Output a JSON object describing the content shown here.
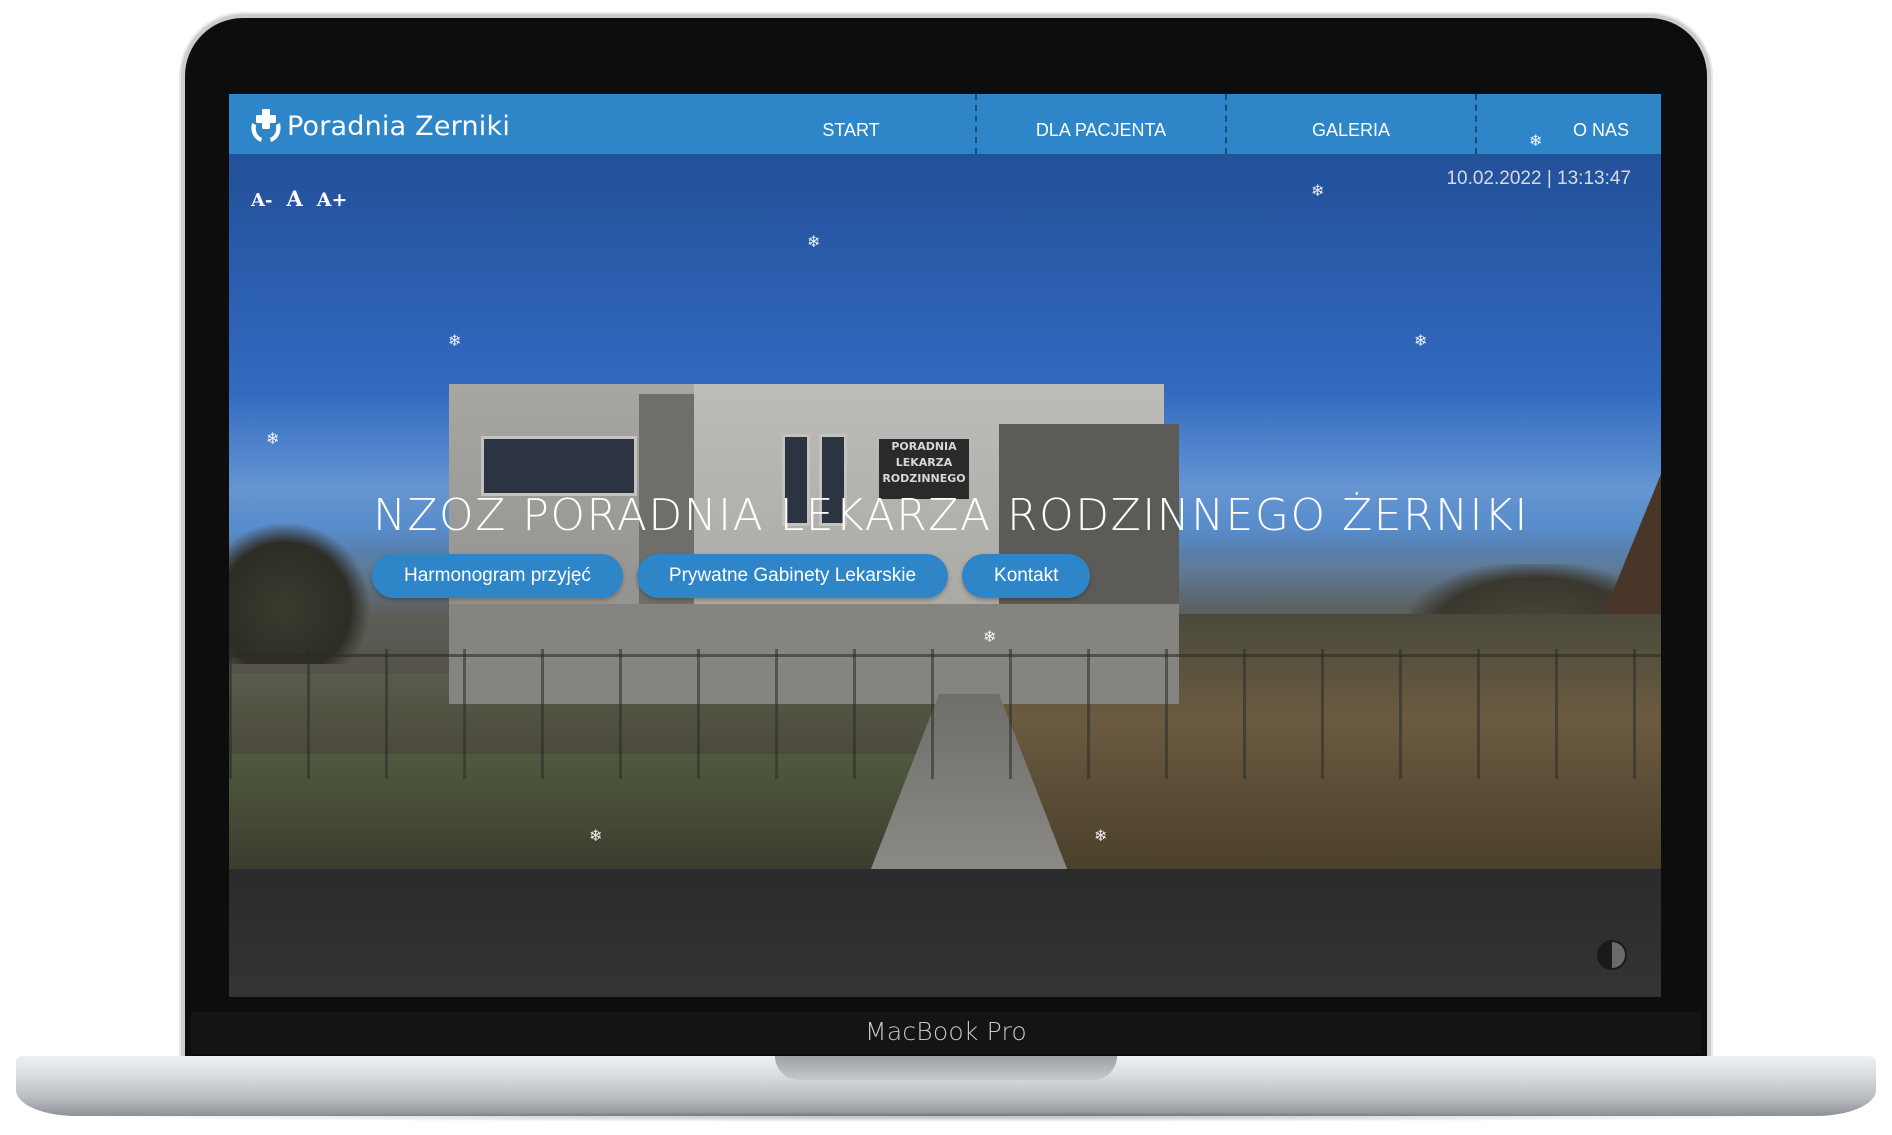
{
  "device": {
    "label": "MacBook Pro"
  },
  "site": {
    "logo_text": "Poradnia Zerniki",
    "nav": [
      "START",
      "DLA PACJENTA",
      "GALERIA",
      "O NAS"
    ],
    "font_controls": {
      "decrease": "A-",
      "normal": "A",
      "increase": "A+"
    },
    "datetime": "10.02.2022 | 13:13:47",
    "hero": {
      "title": "NZOZ PORADNIA LEKARZA RODZINNEGO ŻERNIKI",
      "buttons": [
        "Harmonogram przyjęć",
        "Prywatne Gabinety Lekarskie",
        "Kontakt"
      ]
    },
    "building_sign": [
      "PORADNIA",
      "LEKARZA",
      "RODZINNEGO"
    ],
    "snowflake_glyph": "❄",
    "icons": [
      "medical-cross-hands-icon",
      "contrast-toggle-icon"
    ],
    "colors": {
      "accent": "#2e86c8",
      "text": "#ffffff"
    }
  }
}
